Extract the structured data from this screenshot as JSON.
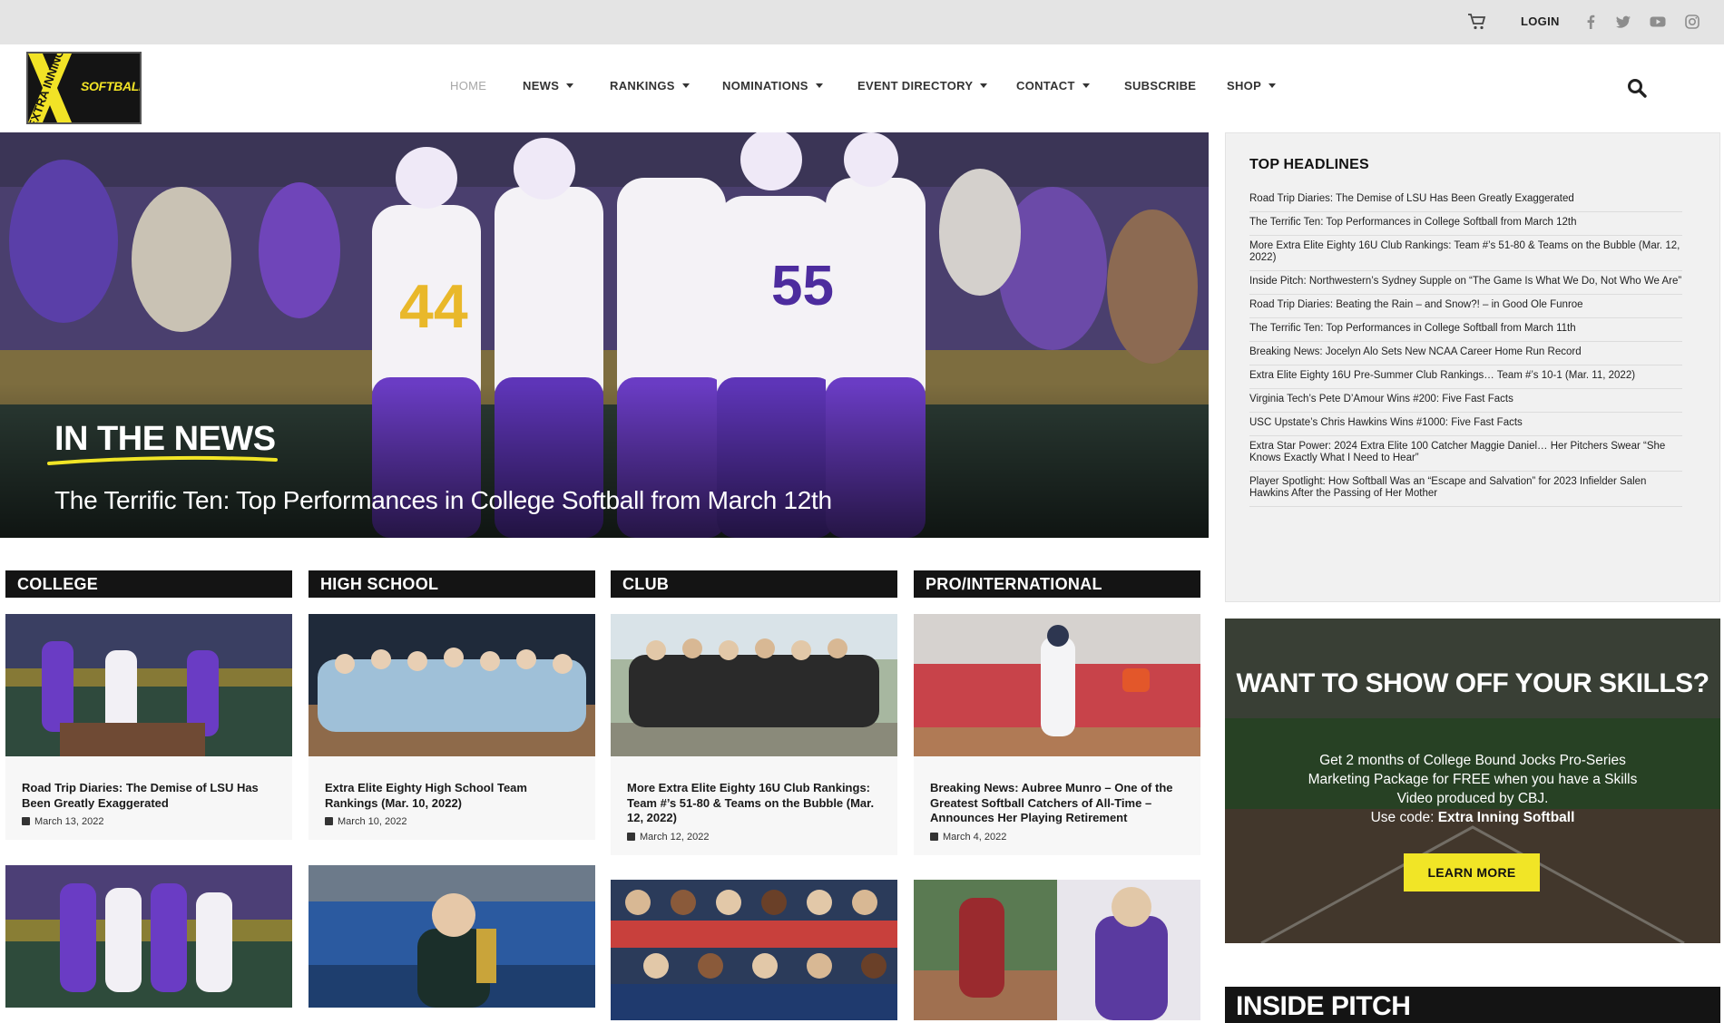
{
  "topbar": {
    "login": "LOGIN",
    "social": [
      "facebook-icon",
      "twitter-icon",
      "youtube-icon",
      "instagram-icon"
    ]
  },
  "logo": {
    "wordmark": "EXTRA INNING",
    "sub": "SOFTBALL"
  },
  "nav": {
    "items": [
      {
        "label": "HOME",
        "caret": false
      },
      {
        "label": "NEWS",
        "caret": true
      },
      {
        "label": "RANKINGS",
        "caret": true
      },
      {
        "label": "NOMINATIONS",
        "caret": true
      },
      {
        "label": "EVENT DIRECTORY",
        "caret": true
      },
      {
        "label": "CONTACT",
        "caret": true
      },
      {
        "label": "SUBSCRIBE",
        "caret": false
      },
      {
        "label": "SHOP",
        "caret": true
      }
    ]
  },
  "hero": {
    "kicker": "IN THE NEWS",
    "headline": "The Terrific Ten: Top Performances in College Softball from March 12th"
  },
  "sidebar": {
    "title": "TOP HEADLINES",
    "items": [
      "Road Trip Diaries: The Demise of LSU Has Been Greatly Exaggerated",
      "The Terrific Ten: Top Performances in College Softball from March 12th",
      "More Extra Elite Eighty 16U Club Rankings: Team #’s 51-80 & Teams on the Bubble (Mar. 12, 2022)",
      "Inside Pitch: Northwestern’s Sydney Supple on “The Game Is What We Do, Not Who We Are”",
      "Road Trip Diaries: Beating the Rain – and Snow?! – in Good Ole Funroe",
      "The Terrific Ten: Top Performances in College Softball from March 11th",
      "Breaking News: Jocelyn Alo Sets New NCAA Career Home Run Record",
      "Extra Elite Eighty 16U Pre-Summer Club Rankings… Team #’s 10-1 (Mar. 11, 2022)",
      "Virginia Tech’s Pete D’Amour Wins #200: Five Fast Facts",
      "USC Upstate’s Chris Hawkins Wins #1000: Five Fast Facts",
      "Extra Star Power: 2024 Extra Elite 100 Catcher Maggie Daniel… Her Pitchers Swear “She Knows Exactly What I Need to Hear”",
      "Player Spotlight: How Softball Was an “Escape and Salvation” for 2023 Infielder Salen Hawkins After the Passing of Her Mother"
    ]
  },
  "promo": {
    "title": "WANT TO SHOW OFF YOUR SKILLS?",
    "body": "Get 2 months of College Bound Jocks Pro-Series Marketing Package for FREE when you have a Skills Video produced by CBJ.",
    "code_label": "Use code: ",
    "code": "Extra Inning Softball",
    "button": "LEARN MORE"
  },
  "inside_pitch": {
    "title": "INSIDE PITCH"
  },
  "categories": [
    {
      "name": "COLLEGE",
      "title": "Road Trip Diaries: The Demise of LSU Has Been Greatly Exaggerated",
      "date": "March 13, 2022"
    },
    {
      "name": "HIGH SCHOOL",
      "title": "Extra Elite Eighty High School Team Rankings (Mar. 10, 2022)",
      "date": "March 10, 2022"
    },
    {
      "name": "CLUB",
      "title": "More Extra Elite Eighty 16U Club Rankings: Team #’s 51-80 & Teams on the Bubble (Mar. 12, 2022)",
      "date": "March 12, 2022"
    },
    {
      "name": "PRO/INTERNATIONAL",
      "title": "Breaking News: Aubree Munro – One of the Greatest Softball Catchers of All-Time – Announces Her Playing Retirement",
      "date": "March 4, 2022"
    }
  ],
  "colors": {
    "accent_yellow": "#f1e526",
    "purple": "#5b2fb5",
    "dark": "#141414"
  }
}
